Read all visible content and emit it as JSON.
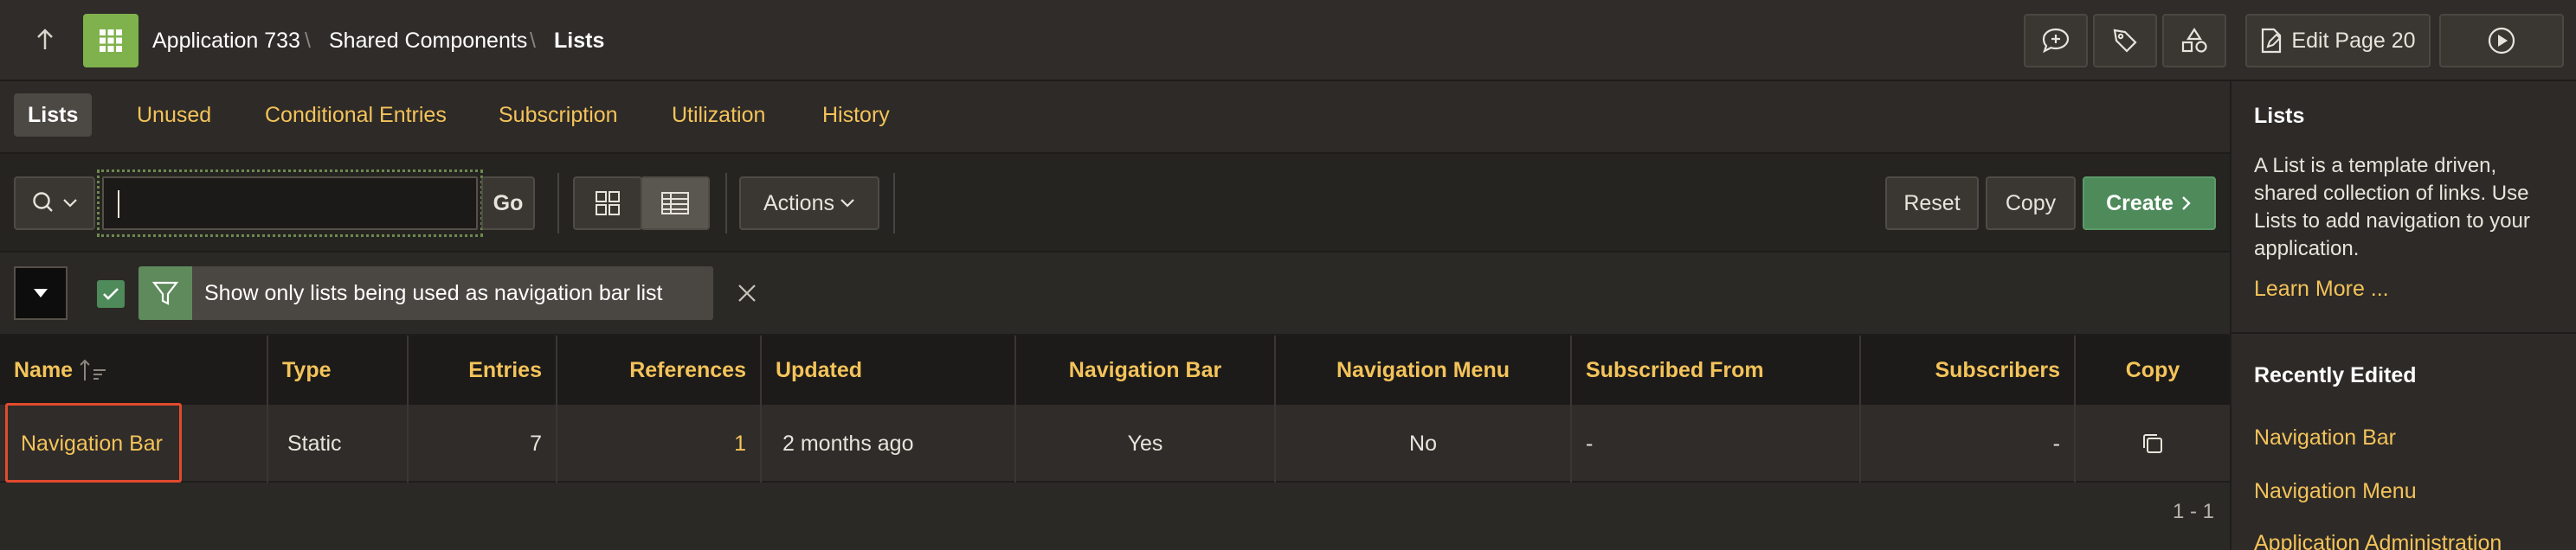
{
  "header": {
    "up_icon": "arrow-up-icon",
    "app_icon": "app-grid-icon",
    "breadcrumb": [
      "Application 733",
      "Shared Components",
      "Lists"
    ],
    "edit_page_label": "Edit Page 20",
    "colors": {
      "app_icon_bg": "#7fb24c",
      "accent": "#f4c35a"
    }
  },
  "tabs": [
    {
      "label": "Lists",
      "active": true
    },
    {
      "label": "Unused"
    },
    {
      "label": "Conditional Entries"
    },
    {
      "label": "Subscription"
    },
    {
      "label": "Utilization"
    },
    {
      "label": "History"
    }
  ],
  "toolbar": {
    "search_value": "",
    "go_label": "Go",
    "actions_label": "Actions",
    "reset_label": "Reset",
    "copy_label": "Copy",
    "create_label": "Create"
  },
  "filter": {
    "text": "Show only lists being used as navigation bar list",
    "checked": true
  },
  "table": {
    "columns": [
      "Name",
      "Type",
      "Entries",
      "References",
      "Updated",
      "Navigation Bar",
      "Navigation Menu",
      "Subscribed From",
      "Subscribers",
      "Copy"
    ],
    "rows": [
      {
        "name": "Navigation Bar",
        "type": "Static",
        "entries": "7",
        "references": "1",
        "updated": "2 months ago",
        "nav_bar": "Yes",
        "nav_menu": "No",
        "subscribed_from": "-",
        "subscribers": "-"
      }
    ],
    "pagination": "1 - 1"
  },
  "right_panel": {
    "title": "Lists",
    "description": "A List is a template driven, shared collection of links. Use Lists to add navigation to your application.",
    "learn_more": "Learn More ...",
    "recent_title": "Recently Edited",
    "recent": [
      "Navigation Bar",
      "Navigation Menu",
      "Application Administration"
    ]
  }
}
